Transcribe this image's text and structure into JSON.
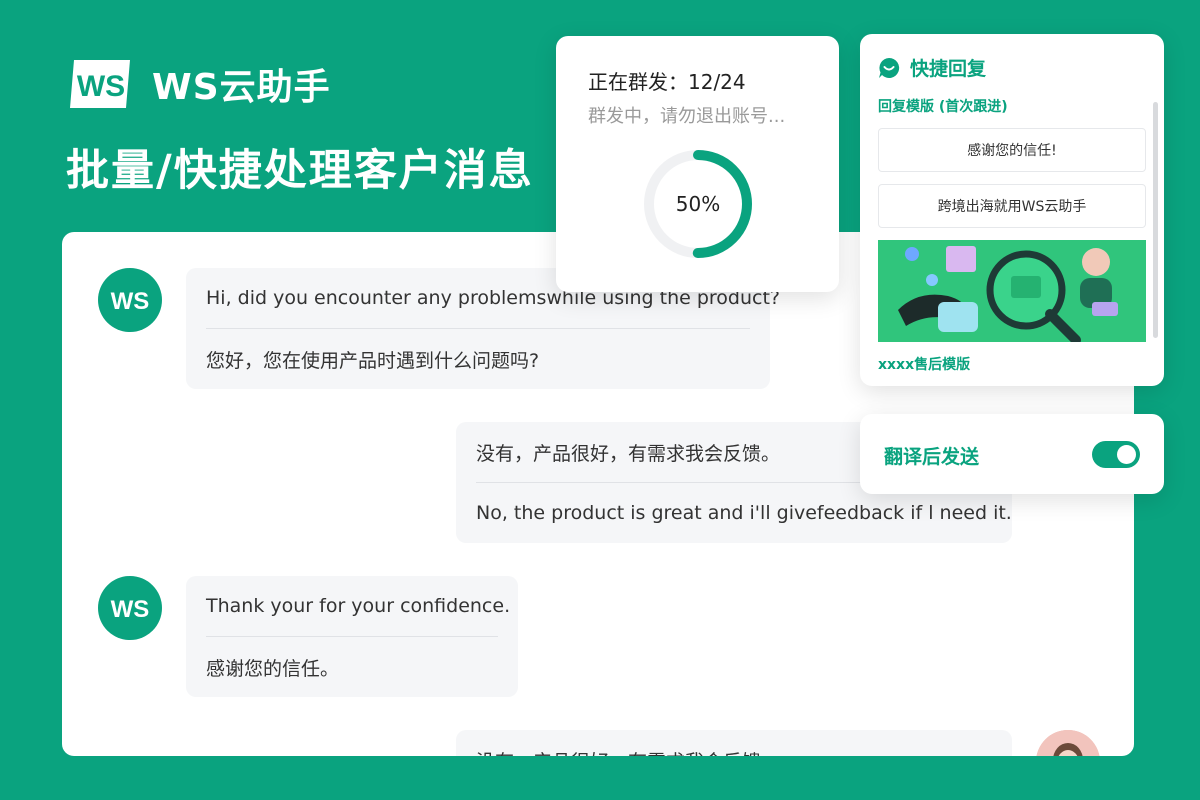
{
  "brand": {
    "logo_text": "WS",
    "name": "WS云助手",
    "headline": "批量/快捷处理客户消息"
  },
  "colors": {
    "primary": "#0aa37f",
    "bubble_bg": "#f5f6f8",
    "muted_text": "#9a9a9a"
  },
  "chat": {
    "messages": [
      {
        "side": "left",
        "lines": [
          "Hi, did you encounter any problemswhile using the product?",
          "您好，您在使用产品时遇到什么问题吗?"
        ]
      },
      {
        "side": "right",
        "lines": [
          "没有，产品很好，有需求我会反馈。",
          "No, the product is great and i'll givefeedback if l need it."
        ]
      },
      {
        "side": "left",
        "lines": [
          "Thank your for your confidence.",
          "感谢您的信任。"
        ]
      },
      {
        "side": "right",
        "lines": [
          "没有，产品很好，有需求我会反馈。"
        ]
      }
    ]
  },
  "progress": {
    "title": "正在群发：12/24",
    "subtitle": "群发中，请勿退出账号...",
    "percent_label": "50%",
    "percent": 0.5
  },
  "quick_reply": {
    "title": "快捷回复",
    "template_label": "回复模版 (首次跟进)",
    "items": [
      "感谢您的信任!",
      "跨境出海就用WS云助手"
    ],
    "image_caption": "xxxx售后模版"
  },
  "translate": {
    "label": "翻译后发送",
    "enabled": true
  }
}
